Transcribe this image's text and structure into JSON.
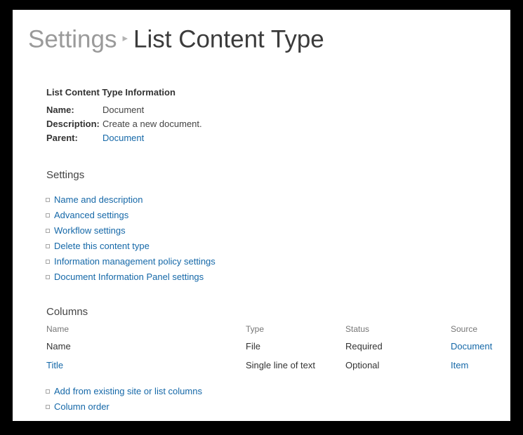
{
  "header": {
    "parent_label": "Settings",
    "separator": "▸",
    "current_label": "List Content Type"
  },
  "info": {
    "heading": "List Content Type Information",
    "rows": [
      {
        "label": "Name:",
        "value": "Document",
        "is_link": false
      },
      {
        "label": "Description:",
        "value": "Create a new document.",
        "is_link": false
      },
      {
        "label": "Parent:",
        "value": "Document",
        "is_link": true
      }
    ]
  },
  "settings_section": {
    "heading": "Settings",
    "links": [
      "Name and description",
      "Advanced settings",
      "Workflow settings",
      "Delete this content type",
      "Information management policy settings",
      "Document Information Panel settings"
    ]
  },
  "columns_section": {
    "heading": "Columns",
    "table": {
      "headers": [
        "Name",
        "Type",
        "Status",
        "Source"
      ],
      "rows": [
        {
          "name": "Name",
          "name_is_link": false,
          "type": "File",
          "status": "Required",
          "source": "Document",
          "source_is_link": true
        },
        {
          "name": "Title",
          "name_is_link": true,
          "type": "Single line of text",
          "status": "Optional",
          "source": "Item",
          "source_is_link": true
        }
      ]
    },
    "links": [
      "Add from existing site or list columns",
      "Column order"
    ]
  },
  "colors": {
    "link": "#1568a8",
    "title_muted": "#9a9a9a",
    "title_current": "#3b3b3b",
    "header_text": "#767676",
    "body_text": "#333333",
    "page_background": "#ffffff",
    "frame": "#000000"
  }
}
